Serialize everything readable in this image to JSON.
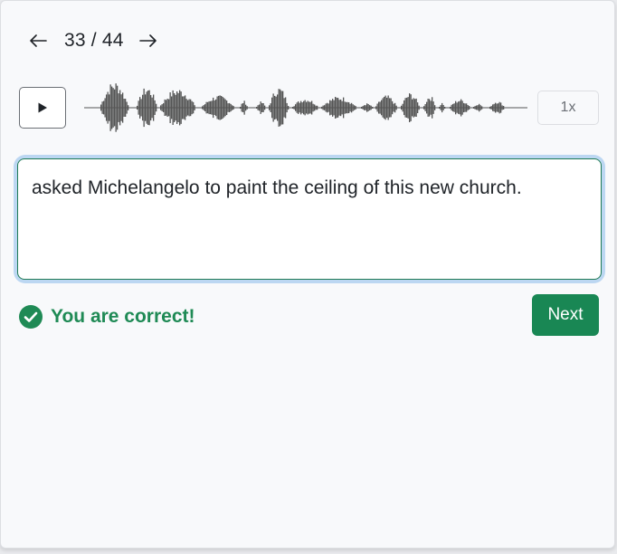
{
  "navigation": {
    "prev_icon": "arrow-left-icon",
    "next_icon": "arrow-right-icon",
    "counter": "33 / 44"
  },
  "player": {
    "play_icon": "play-icon",
    "speed_label": "1x"
  },
  "answer": {
    "text": "asked Michelangelo to paint the ceiling of this new church."
  },
  "feedback": {
    "icon": "check-circle-icon",
    "message": "You are correct!",
    "color": "#1f8a55"
  },
  "next_button": {
    "label": "Next",
    "color": "#198754"
  }
}
